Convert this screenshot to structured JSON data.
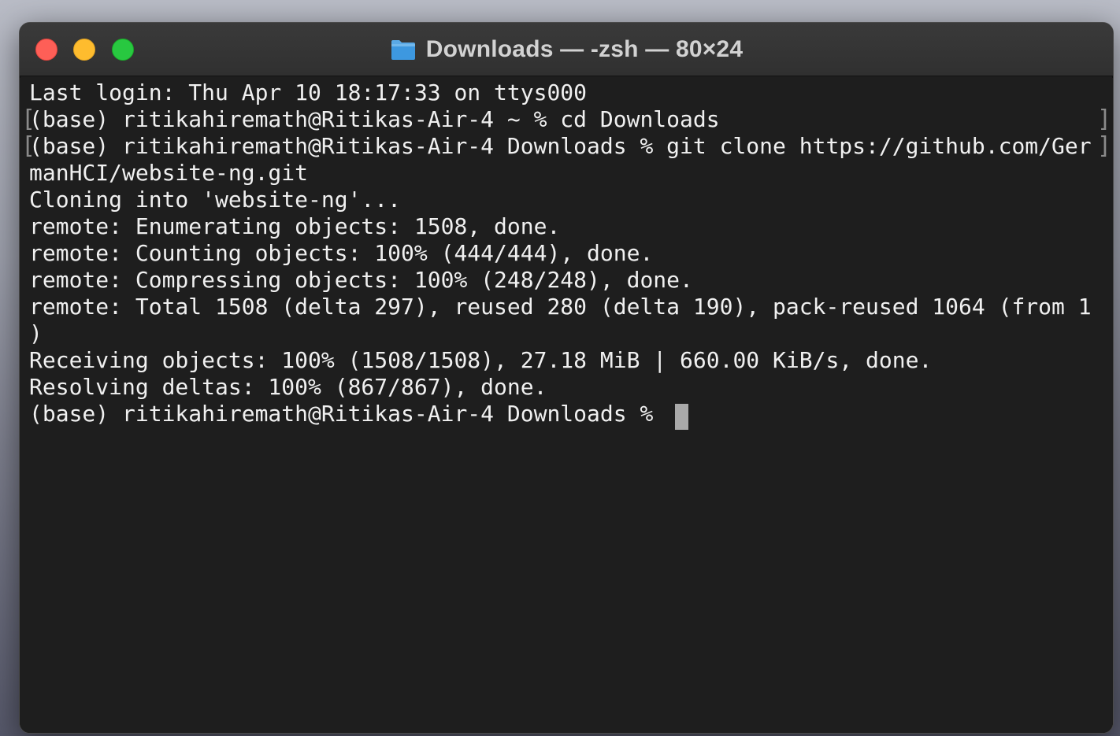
{
  "window": {
    "title": "Downloads — -zsh — 80×24",
    "icon": "folder-icon"
  },
  "colors": {
    "close": "#fe5f57",
    "minimize": "#febc2e",
    "zoom": "#28c840",
    "background": "#1e1e1e",
    "text": "#f0f0f0"
  },
  "terminal": {
    "lines": [
      "Last login: Thu Apr 10 18:17:33 on ttys000",
      "(base) ritikahiremath@Ritikas-Air-4 ~ % cd Downloads",
      "(base) ritikahiremath@Ritikas-Air-4 Downloads % git clone https://github.com/Ger",
      "manHCI/website-ng.git",
      "Cloning into 'website-ng'...",
      "remote: Enumerating objects: 1508, done.",
      "remote: Counting objects: 100% (444/444), done.",
      "remote: Compressing objects: 100% (248/248), done.",
      "remote: Total 1508 (delta 297), reused 280 (delta 190), pack-reused 1064 (from 1",
      ")",
      "Receiving objects: 100% (1508/1508), 27.18 MiB | 660.00 KiB/s, done.",
      "Resolving deltas: 100% (867/867), done.",
      "(base) ritikahiremath@Ritikas-Air-4 Downloads % "
    ],
    "bracket_left": "[",
    "bracket_right": "]"
  }
}
